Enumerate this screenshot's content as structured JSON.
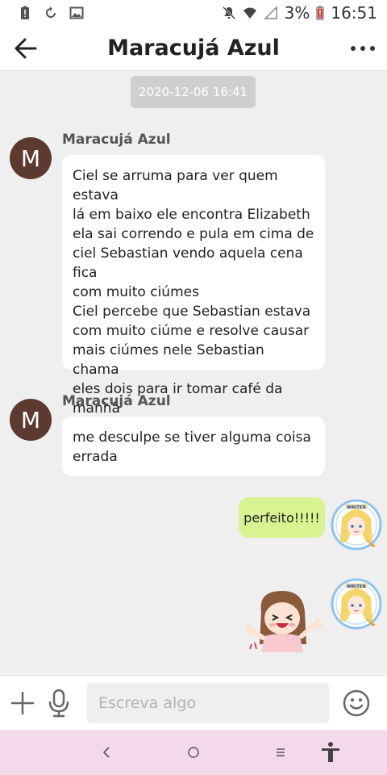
{
  "status_bar": {
    "battery_percent": "3%",
    "time": "16:51",
    "icons": [
      "battery-alert-icon",
      "rotate-icon",
      "image-icon",
      "notifications-off-icon",
      "wifi-icon",
      "signal-icon",
      "battery-low-icon"
    ]
  },
  "header": {
    "title": "Maracujá Azul",
    "back_icon": "arrow-left-icon",
    "menu_icon": "more-dots-icon"
  },
  "chat": {
    "timestamp": "2020-12-06 16:41",
    "messages": [
      {
        "direction": "incoming",
        "avatar_letter": "M",
        "sender": "Maracujá Azul",
        "lines": [
          "Ciel se arruma para ver quem estava",
          "lá em baixo  ele encontra Elizabeth",
          "ela sai correndo e pula em cima de",
          "ciel Sebastian vendo aquela cena fica",
          "com muito ciúmes",
          "Ciel percebe que Sebastian estava",
          "com muito ciúme e resolve causar",
          "mais ciúmes nele Sebastian chama",
          "eles dois para ir tomar café da",
          "manhã"
        ]
      },
      {
        "direction": "incoming",
        "avatar_letter": "M",
        "sender": "Maracujá Azul",
        "lines": [
          "me desculpe se tiver alguma coisa",
          "errada"
        ]
      },
      {
        "direction": "outgoing",
        "text": "perfeito!!!!!",
        "avatar_badge": "WRITER"
      },
      {
        "direction": "outgoing",
        "type": "sticker",
        "avatar_badge": "WRITER"
      }
    ]
  },
  "input_bar": {
    "placeholder": "Escreva algo",
    "icons": [
      "plus-icon",
      "microphone-icon",
      "emoji-icon"
    ]
  },
  "nav_bar": {
    "icons": [
      "nav-back-icon",
      "nav-home-icon",
      "nav-recents-icon",
      "accessibility-icon"
    ],
    "background": "#f4d9ea"
  },
  "colors": {
    "outgoing_bubble": "#d8f391",
    "avatar_letter_bg": "#5d3a2f",
    "timestamp_bg": "#cfcfcf"
  }
}
